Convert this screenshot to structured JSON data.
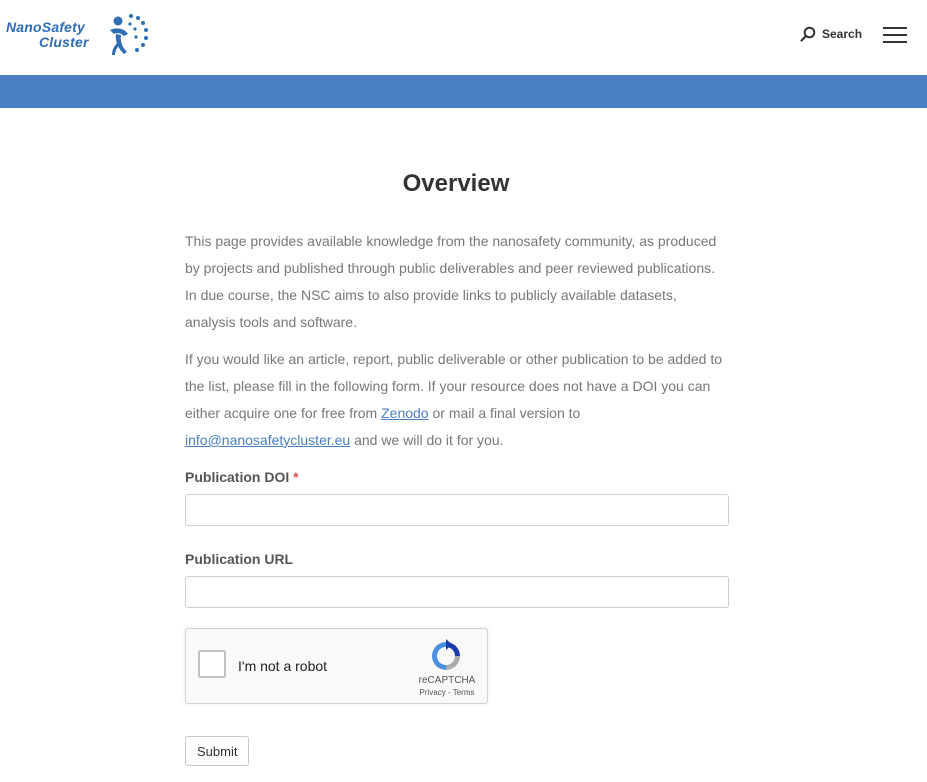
{
  "header": {
    "logo_line1": "NanoSafety",
    "logo_line2": "Cluster",
    "search_label": "Search"
  },
  "main": {
    "title": "Overview",
    "intro": "This page provides available knowledge from the nanosafety community, as produced by projects and published through public deliverables and peer reviewed publications. In due course, the NSC aims to also provide links to publicly available datasets, analysis tools and software.",
    "p2_part1": "If you would like an article, report, public deliverable or other publication to be added to the list, please fill in the following form. If your resource does not have a DOI you can either acquire one for free from ",
    "zenodo_link": "Zenodo",
    "p2_part2": " or mail a final version to ",
    "email_link": "info@nanosafetycluster.eu",
    "p2_part3": " and we will do it for you."
  },
  "form": {
    "doi_label": "Publication DOI",
    "required_mark": "*",
    "doi_value": "",
    "url_label": "Publication URL",
    "url_value": "",
    "captcha_label": "I'm not a robot",
    "captcha_brand": "reCAPTCHA",
    "captcha_links": "Privacy - Terms",
    "submit_label": "Submit"
  },
  "colors": {
    "accent": "#4a7fc1",
    "logo": "#2f6db5"
  }
}
